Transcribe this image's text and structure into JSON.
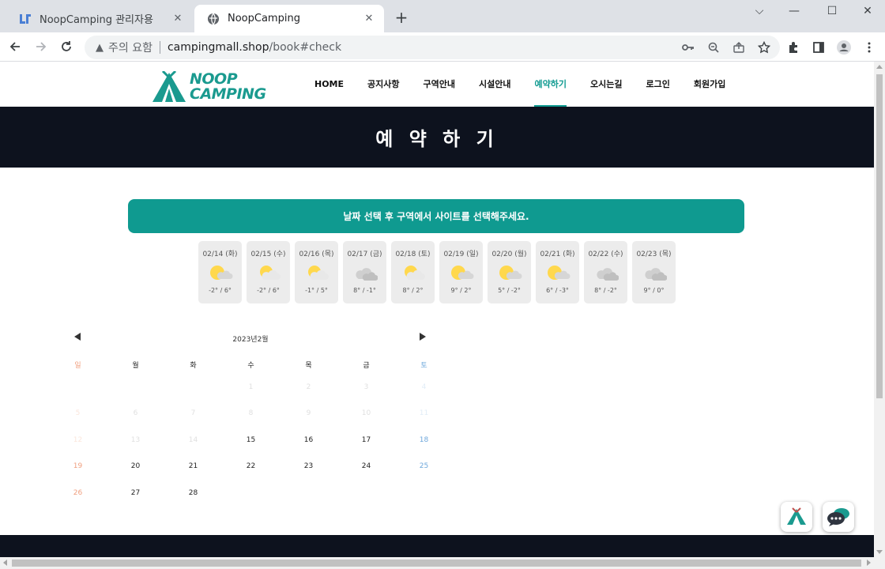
{
  "browser": {
    "tabs": [
      {
        "title": "NoopCamping 관리자용",
        "active": false
      },
      {
        "title": "NoopCamping",
        "active": true
      }
    ],
    "address": {
      "security_label": "주의 요함",
      "host": "campingmall.shop",
      "path": "/book#check"
    }
  },
  "site": {
    "logo": {
      "line1": "NOOP",
      "line2": "CAMPING"
    },
    "nav": [
      {
        "label": "HOME",
        "active": false
      },
      {
        "label": "공지사항",
        "active": false
      },
      {
        "label": "구역안내",
        "active": false
      },
      {
        "label": "시설안내",
        "active": false
      },
      {
        "label": "예약하기",
        "active": true
      },
      {
        "label": "오시는길",
        "active": false
      },
      {
        "label": "로그인",
        "active": false
      },
      {
        "label": "회원가입",
        "active": false
      }
    ],
    "page_title": "예 약 하 기",
    "notice": "날짜 선택 후 구역에서 사이트를 선택해주세요.",
    "accent_color": "#0f9a90"
  },
  "forecast": [
    {
      "date": "02/14 (화)",
      "icon": "sun-cloud",
      "temp": "-2° / 6°"
    },
    {
      "date": "02/15 (수)",
      "icon": "sun-cloud-big",
      "temp": "-2° / 6°"
    },
    {
      "date": "02/16 (목)",
      "icon": "sun-cloud-big",
      "temp": "-1° / 5°"
    },
    {
      "date": "02/17 (금)",
      "icon": "cloud",
      "temp": "8° / -1°"
    },
    {
      "date": "02/18 (토)",
      "icon": "sun-cloud-big",
      "temp": "8° / 2°"
    },
    {
      "date": "02/19 (일)",
      "icon": "sun-cloud",
      "temp": "9° / 2°"
    },
    {
      "date": "02/20 (월)",
      "icon": "sun-cloud",
      "temp": "5° / -2°"
    },
    {
      "date": "02/21 (화)",
      "icon": "sun-cloud",
      "temp": "6° / -3°"
    },
    {
      "date": "02/22 (수)",
      "icon": "cloud",
      "temp": "8° / -2°"
    },
    {
      "date": "02/23 (목)",
      "icon": "cloud",
      "temp": "9° / 0°"
    }
  ],
  "calendar": {
    "title": "2023년2월",
    "weekdays": [
      "일",
      "월",
      "화",
      "수",
      "목",
      "금",
      "토"
    ],
    "weeks": [
      [
        null,
        null,
        null,
        "1",
        "2",
        "3",
        "4"
      ],
      [
        "5",
        "6",
        "7",
        "8",
        "9",
        "10",
        "11"
      ],
      [
        "12",
        "13",
        "14",
        "15",
        "16",
        "17",
        "18"
      ],
      [
        "19",
        "20",
        "21",
        "22",
        "23",
        "24",
        "25"
      ],
      [
        "26",
        "27",
        "28",
        null,
        null,
        null,
        null
      ]
    ],
    "first_selectable_day": 15
  }
}
